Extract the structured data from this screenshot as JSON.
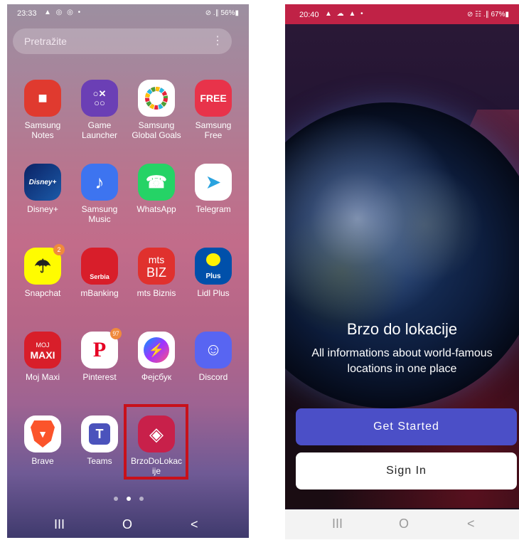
{
  "left_phone": {
    "status": {
      "time": "23:33",
      "icons": "▲ ◎ ◎ •",
      "right": "⊘ .∥ 56%▮"
    },
    "search": {
      "placeholder": "Pretražite"
    },
    "apps": [
      {
        "label": "Samsung\nNotes",
        "icon": "notes-icon",
        "color": "#e03a2f"
      },
      {
        "label": "Game\nLauncher",
        "icon": "game-launcher-icon",
        "color": "#6b3fb5"
      },
      {
        "label": "Samsung\nGlobal Goals",
        "icon": "global-goals-icon",
        "color": "#ffffff"
      },
      {
        "label": "Samsung\nFree",
        "icon": "samsung-free-icon",
        "color": "#e8334a"
      },
      {
        "label": "Disney+",
        "icon": "disney-icon",
        "color": "#0b2265"
      },
      {
        "label": "Samsung\nMusic",
        "icon": "music-icon",
        "color": "#3d74f0"
      },
      {
        "label": "WhatsApp",
        "icon": "whatsapp-icon",
        "color": "#25d366"
      },
      {
        "label": "Telegram",
        "icon": "telegram-icon",
        "color": "#ffffff"
      },
      {
        "label": "Snapchat",
        "icon": "snapchat-icon",
        "color": "#fffc00",
        "badge": "2"
      },
      {
        "label": "mBanking",
        "icon": "mbanking-icon",
        "color": "#d81e2a"
      },
      {
        "label": "mts Biznis",
        "icon": "mts-biz-icon",
        "color": "#e0312e"
      },
      {
        "label": "Lidl Plus",
        "icon": "lidl-icon",
        "color": "#0050aa"
      },
      {
        "label": "Moj Maxi",
        "icon": "maxi-icon",
        "color": "#d81e2a"
      },
      {
        "label": "Pinterest",
        "icon": "pinterest-icon",
        "color": "#e60023",
        "badge": "97"
      },
      {
        "label": "Фејсбук",
        "icon": "messenger-icon",
        "color": "#ffffff"
      },
      {
        "label": "Discord",
        "icon": "discord-icon",
        "color": "#5865f2"
      },
      {
        "label": "Brave",
        "icon": "brave-icon",
        "color": "#ffffff"
      },
      {
        "label": "Teams",
        "icon": "teams-icon",
        "color": "#ffffff"
      },
      {
        "label": "BrzoDoLokac\nije",
        "icon": "brzodolokacije-icon",
        "color": "#c8204a"
      }
    ],
    "icon_text": {
      "notes": "■",
      "game": "○✕\n○○",
      "goals": "◎",
      "free": "FREE",
      "disney": "Disney+",
      "music": "♪",
      "whatsapp": "☎",
      "telegram": "➤",
      "snapchat": "☂",
      "mbanking": "Serbia",
      "mts_top": "mts",
      "mts_bottom": "BIZ",
      "lidl": "Plus",
      "maxi_top": "MOJ",
      "maxi_bottom": "MAXI",
      "pinterest": "P",
      "messenger": "⚡",
      "discord": "☺",
      "brave": "▼",
      "teams": "T",
      "brzo": "◈"
    },
    "nav": {
      "recent": "III",
      "home": "O",
      "back": "<"
    }
  },
  "right_phone": {
    "status": {
      "time": "20:40",
      "icons": "▲ ☁ ▲ •",
      "right": "⊘ ☷ .∥ 67%▮"
    },
    "title": "Brzo do lokacije",
    "subtitle": "All informations about world-famous locations in one place",
    "get_started": "Get Started",
    "sign_in": "Sign In",
    "nav": {
      "recent": "III",
      "home": "O",
      "back": "<"
    }
  }
}
